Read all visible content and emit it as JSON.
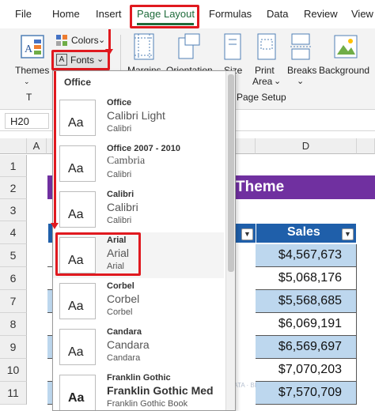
{
  "tabs": [
    {
      "label": "File"
    },
    {
      "label": "Home"
    },
    {
      "label": "Insert"
    },
    {
      "label": "Page Layout"
    },
    {
      "label": "Formulas"
    },
    {
      "label": "Data"
    },
    {
      "label": "Review"
    },
    {
      "label": "View"
    }
  ],
  "active_tab": "Page Layout",
  "ribbon": {
    "themes_label": "Themes",
    "colors_label": "Colors",
    "fonts_label": "Fonts",
    "group_page_setup": "Page Setup",
    "buttons": [
      {
        "label": "Margins"
      },
      {
        "label": "Orientation"
      },
      {
        "label": "Size"
      },
      {
        "label": "Print"
      },
      {
        "label": "Area"
      },
      {
        "label": "Breaks"
      },
      {
        "label": "Background"
      }
    ]
  },
  "namebox": "H20",
  "columns": [
    "A",
    "D"
  ],
  "rows": [
    "1",
    "2",
    "3",
    "4",
    "5",
    "6",
    "7",
    "8",
    "9",
    "10",
    "11"
  ],
  "sheet": {
    "title_fragment": "Theme",
    "header": "Sales",
    "values": [
      "$4,567,673",
      "$5,068,176",
      "$5,568,685",
      "$6,069,191",
      "$6,569,697",
      "$7,070,203",
      "$7,570,709"
    ]
  },
  "fonts_panel": {
    "heading": "Office",
    "items": [
      {
        "name": "Office",
        "heading_font": "Calibri Light",
        "body_font": "Calibri",
        "thumb": "Aa"
      },
      {
        "name": "Office 2007 - 2010",
        "heading_font": "Cambria",
        "body_font": "Calibri",
        "thumb": "Aa"
      },
      {
        "name": "Calibri",
        "heading_font": "Calibri",
        "body_font": "Calibri",
        "thumb": "Aa"
      },
      {
        "name": "Arial",
        "heading_font": "Arial",
        "body_font": "Arial",
        "thumb": "Aa"
      },
      {
        "name": "Corbel",
        "heading_font": "Corbel",
        "body_font": "Corbel",
        "thumb": "Aa"
      },
      {
        "name": "Candara",
        "heading_font": "Candara",
        "body_font": "Candara",
        "thumb": "Aa"
      },
      {
        "name": "Franklin Gothic",
        "heading_font": "Franklin Gothic Med",
        "body_font": "Franklin Gothic Book",
        "thumb": "Aa"
      }
    ]
  },
  "watermark": {
    "brand": "exceldemy",
    "tagline": "EXCEL · DATA · BI"
  },
  "colors": {
    "accent_green": "#1e6b3a",
    "highlight_red": "#e0191f",
    "title_purple": "#7030a0",
    "header_blue": "#1f5faa",
    "row_light_blue": "#bdd7ee"
  }
}
